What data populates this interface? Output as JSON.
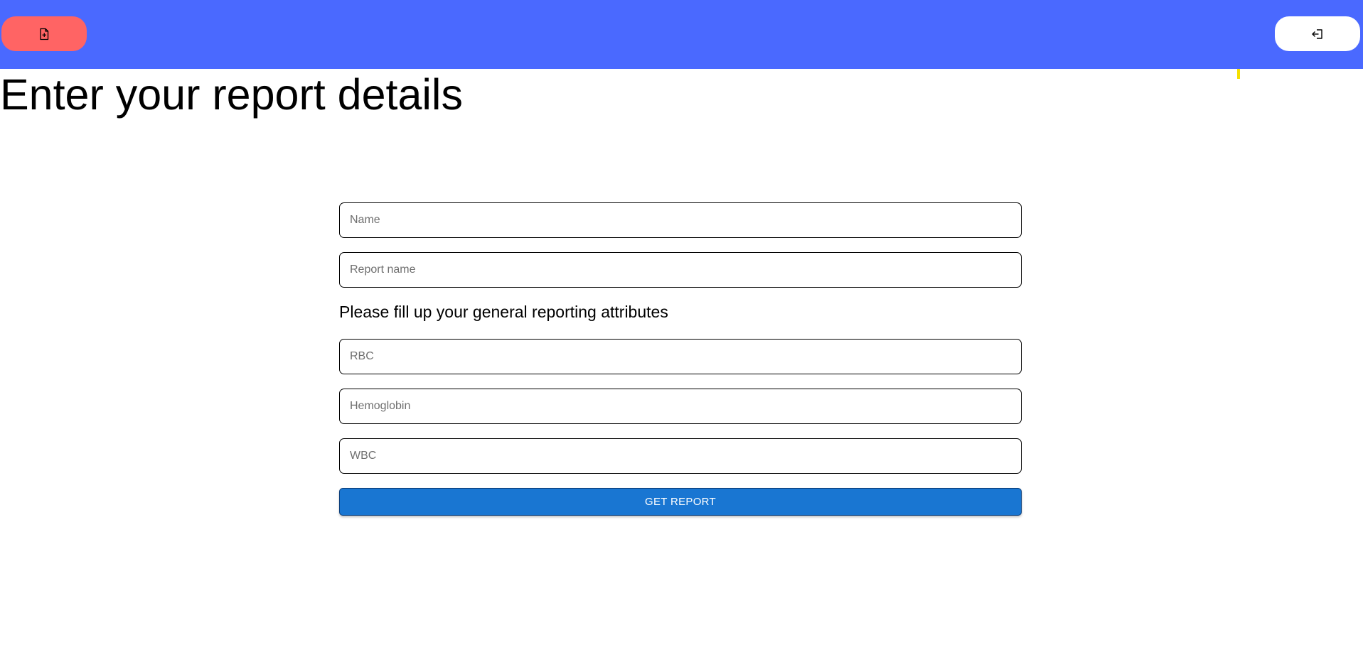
{
  "header": {
    "background": "#4a69ff",
    "new_report_icon": "file-plus-icon",
    "new_report_color": "#ff6464",
    "logout_icon": "logout-icon"
  },
  "page": {
    "title": "Enter your report details"
  },
  "form": {
    "name_placeholder": "Name",
    "report_name_placeholder": "Report name",
    "attributes_label": "Please fill up your general reporting attributes",
    "rbc_placeholder": "RBC",
    "hemoglobin_placeholder": "Hemoglobin",
    "wbc_placeholder": "WBC",
    "submit_label": "GET REPORT",
    "submit_color": "#1976d2"
  }
}
